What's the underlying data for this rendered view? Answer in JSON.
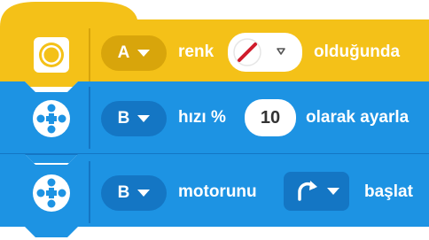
{
  "colors": {
    "event_yellow": "#f4c118",
    "event_dark": "#d8a50b",
    "motor_blue": "#1d93e3",
    "motor_dark": "#1476c4"
  },
  "blocks": [
    {
      "kind": "event",
      "icon": "color-sensor-icon",
      "port": "A",
      "label": "renk",
      "value_icon": "red-slash-color-icon",
      "suffix": "olduğunda"
    },
    {
      "kind": "motor",
      "icon": "motor-icon",
      "port": "B",
      "label": "hızı %",
      "value": "10",
      "suffix": "olarak ayarla"
    },
    {
      "kind": "motor",
      "icon": "motor-icon",
      "port": "B",
      "label": "motorunu",
      "value_icon": "clockwise-arrow-icon",
      "suffix": "başlat"
    }
  ]
}
